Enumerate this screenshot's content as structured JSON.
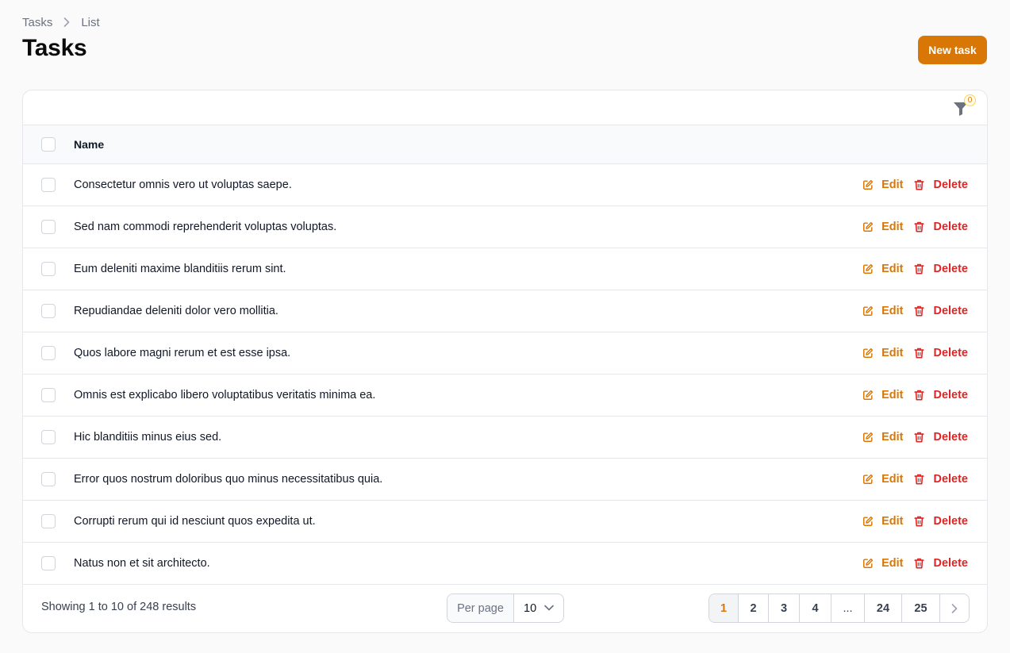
{
  "breadcrumb": {
    "parent": "Tasks",
    "current": "List"
  },
  "page": {
    "title": "Tasks",
    "new_button": "New task"
  },
  "filter": {
    "count": "0"
  },
  "table": {
    "columns": {
      "name": "Name"
    },
    "rows": [
      {
        "name": "Consectetur omnis vero ut voluptas saepe."
      },
      {
        "name": "Sed nam commodi reprehenderit voluptas voluptas."
      },
      {
        "name": "Eum deleniti maxime blanditiis rerum sint."
      },
      {
        "name": "Repudiandae deleniti dolor vero mollitia."
      },
      {
        "name": "Quos labore magni rerum et est esse ipsa."
      },
      {
        "name": "Omnis est explicabo libero voluptatibus veritatis minima ea."
      },
      {
        "name": "Hic blanditiis minus eius sed."
      },
      {
        "name": "Error quos nostrum doloribus quo minus necessitatibus quia."
      },
      {
        "name": "Corrupti rerum qui id nesciunt quos expedita ut."
      },
      {
        "name": "Natus non et sit architecto."
      }
    ],
    "edit_label": "Edit",
    "delete_label": "Delete"
  },
  "footer": {
    "showing": "Showing 1 to 10 of 248 results",
    "per_page_label": "Per page",
    "per_page_value": "10",
    "pages": [
      "1",
      "2",
      "3",
      "4",
      "...",
      "24",
      "25"
    ],
    "active_page": "1"
  },
  "colors": {
    "accent": "#d97706",
    "danger": "#dc2626"
  },
  "icons": [
    "chevron-right-icon",
    "filter-icon",
    "edit-icon",
    "trash-icon",
    "chevron-down-icon"
  ]
}
